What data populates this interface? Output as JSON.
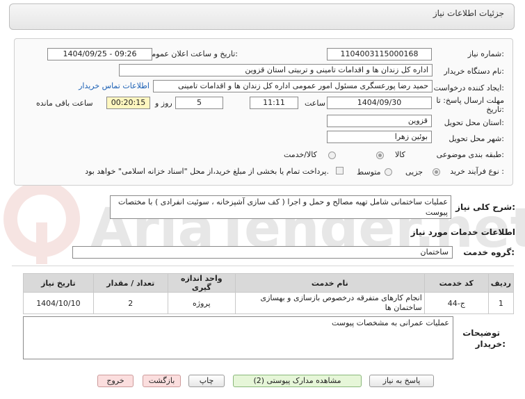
{
  "header": {
    "title": "جزئیات اطلاعات نیاز"
  },
  "fields": {
    "need_number_label": "شماره نیاز:",
    "need_number": "1104003115000168",
    "announce_label": "تاریخ و ساعت اعلان عمومی:",
    "announce_value": "1404/09/25 - 09:26",
    "buyer_label": "نام دستگاه خریدار:",
    "buyer_value": "اداره کل زندان ها و اقدامات تامینی و تربیتی استان قزوین",
    "creator_label": "ایجاد کننده درخواست:",
    "creator_value": "حمید رضا  پورعسگری مسئول امور عمومی  اداره کل زندان ها و اقدامات تامینی",
    "contact_link": "اطلاعات تماس خریدار",
    "deadline_label_1": "مهلت ارسال پاسخ: تا",
    "deadline_label_2": "تاریخ:",
    "deadline_date": "1404/09/30",
    "time_label": "ساعت",
    "deadline_time": "11:11",
    "days_value": "5",
    "days_label": "روز و",
    "remaining_value": "00:20:15",
    "remaining_label": "ساعت باقی مانده",
    "province_label": "استان محل تحویل:",
    "province_value": "قزوین",
    "city_label": "شهر محل تحویل:",
    "city_value": "بوئین زهرا",
    "category_label": "طبقه بندی موضوعی:",
    "category_options": [
      "کالا",
      "کالا/خدمت"
    ],
    "process_label": "نوع فرآیند خرید :",
    "process_options": [
      "جزیی",
      "متوسط"
    ],
    "payment_text": "پرداخت تمام یا بخشی از مبلغ خرید،از محل \"اسناد خزانه اسلامی\" خواهد بود."
  },
  "summary": {
    "label": "شرح کلی نیاز:",
    "value": "عملیات ساختمانی شامل تهیه مصالح و حمل و اجرا ( کف سازی آشپزخانه ، سوئیت انفرادی ) با مختصات پیوست"
  },
  "services": {
    "title": "اطلاعات خدمات مورد نیاز",
    "group_label": "گروه خدمت:",
    "group_value": "ساختمان",
    "columns": [
      "ردیف",
      "کد خدمت",
      "نام خدمت",
      "واحد اندازه گیری",
      "تعداد / مقدار",
      "تاریخ نیاز"
    ],
    "rows": [
      [
        "1",
        "ج-44",
        "انجام کارهای متفرقه درخصوص بازسازی و بهسازی ساختمان ها",
        "پروژه",
        "2",
        "1404/10/10"
      ]
    ]
  },
  "notes": {
    "label_1": "توضیحات",
    "label_2": "خریدار:",
    "value": "عملیات عمرانی به مشخصات پیوست"
  },
  "buttons": {
    "reply": "پاسخ به نیاز",
    "docs": "مشاهده مدارک پیوستی (2)",
    "print": "چاپ",
    "back": "بازگشت",
    "exit": "خروج"
  },
  "colors": {
    "accent_link": "#1a5fb4",
    "remaining_bg": "#fff7c0",
    "table_header": "#d9d9d9"
  }
}
